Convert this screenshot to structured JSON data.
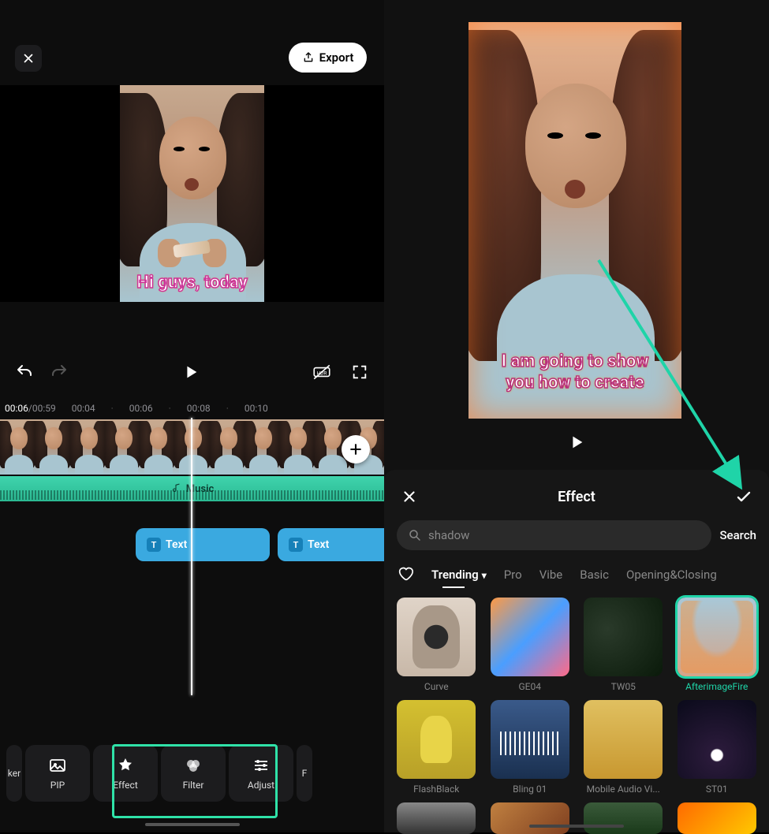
{
  "left": {
    "export_label": "Export",
    "preview_caption": "Hi guys, today",
    "time": {
      "current": "00:06",
      "total": "00:59",
      "ticks": [
        "00:04",
        "·",
        "00:06",
        "·",
        "00:08",
        "·",
        "00:10"
      ]
    },
    "music_label": "Music",
    "text_clip_label": "Text",
    "tools": {
      "sticker": "ker",
      "pip": "PIP",
      "effect": "Effect",
      "filter": "Filter",
      "adjust": "Adjust",
      "format_cut": "F"
    }
  },
  "right": {
    "preview_caption_line1": "I am going to show",
    "preview_caption_line2": "you how to create",
    "panel": {
      "title": "Effect",
      "search_value": "shadow",
      "search_button": "Search",
      "tabs": [
        "Trending",
        "Pro",
        "Vibe",
        "Basic",
        "Opening&Closing"
      ],
      "active_tab": "Trending",
      "effects": [
        {
          "name": "Curve"
        },
        {
          "name": "GE04"
        },
        {
          "name": "TW05"
        },
        {
          "name": "AfterimageFire",
          "selected": true
        },
        {
          "name": "FlashBlack"
        },
        {
          "name": "Bling 01"
        },
        {
          "name": "Mobile Audio Vi..."
        },
        {
          "name": "ST01"
        }
      ]
    }
  }
}
